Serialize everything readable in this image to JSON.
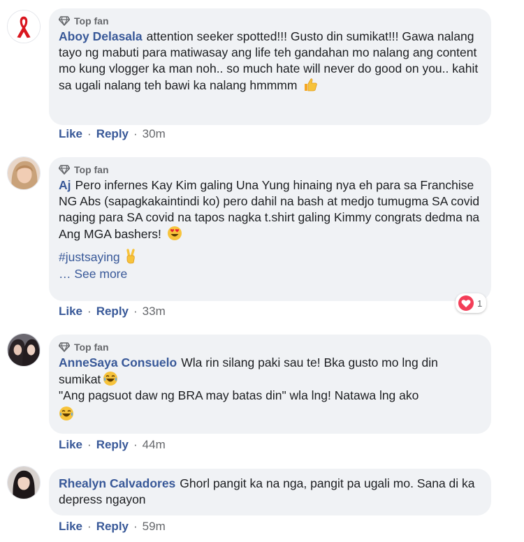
{
  "comments": [
    {
      "badge": "Top fan",
      "author": "Aboy Delasala",
      "text": "attention seeker spotted!!! Gusto din sumikat!!! Gawa nalang tayo ng mabuti para matiwasay ang life teh gandahan mo nalang ang content mo kung vlogger ka man noh.. so much hate will never do good on you.. kahit sa ugali nalang teh bawi ka nalang hmmmm",
      "emoji": "thumbs-up-emoji",
      "like": "Like",
      "reply": "Reply",
      "time": "30m"
    },
    {
      "badge": "Top fan",
      "author": "Aj",
      "text": "Pero infernes Kay Kim galing Una Yung hinaing nya eh para sa Franchise NG Abs (sapagkakaintindi ko) pero dahil na bash at medjo tumugma SA covid naging para SA covid na tapos nagka t.shirt galing Kimmy congrats dedma na Ang MGA bashers!",
      "emoji": "heart-eyes-emoji",
      "hashtag": "#justsaying",
      "hashtag_emoji": "victory-hand-emoji",
      "see_more": "… See more",
      "like": "Like",
      "reply": "Reply",
      "time": "33m",
      "reaction_count": "1",
      "reaction_color": "#f33e58"
    },
    {
      "badge": "Top fan",
      "author": "AnneSaya Consuelo",
      "text_line1": "Wla rin silang paki sau te! Bka gusto mo lng din sumikat",
      "text_line2": "\"Ang pagsuot daw ng BRA may batas din\" wla lng! Natawa lng ako",
      "emoji": "laughing-crying-emoji",
      "like": "Like",
      "reply": "Reply",
      "time": "44m"
    },
    {
      "author": "Rhealyn Calvadores",
      "text": "Ghorl pangit ka na nga, pangit pa ugali mo. Sana di ka depress ngayon",
      "like": "Like",
      "reply": "Reply",
      "time": "59m"
    }
  ],
  "colors": {
    "bubble": "#f0f2f5",
    "link": "#385898",
    "meta": "#65676b"
  },
  "separator": "·"
}
